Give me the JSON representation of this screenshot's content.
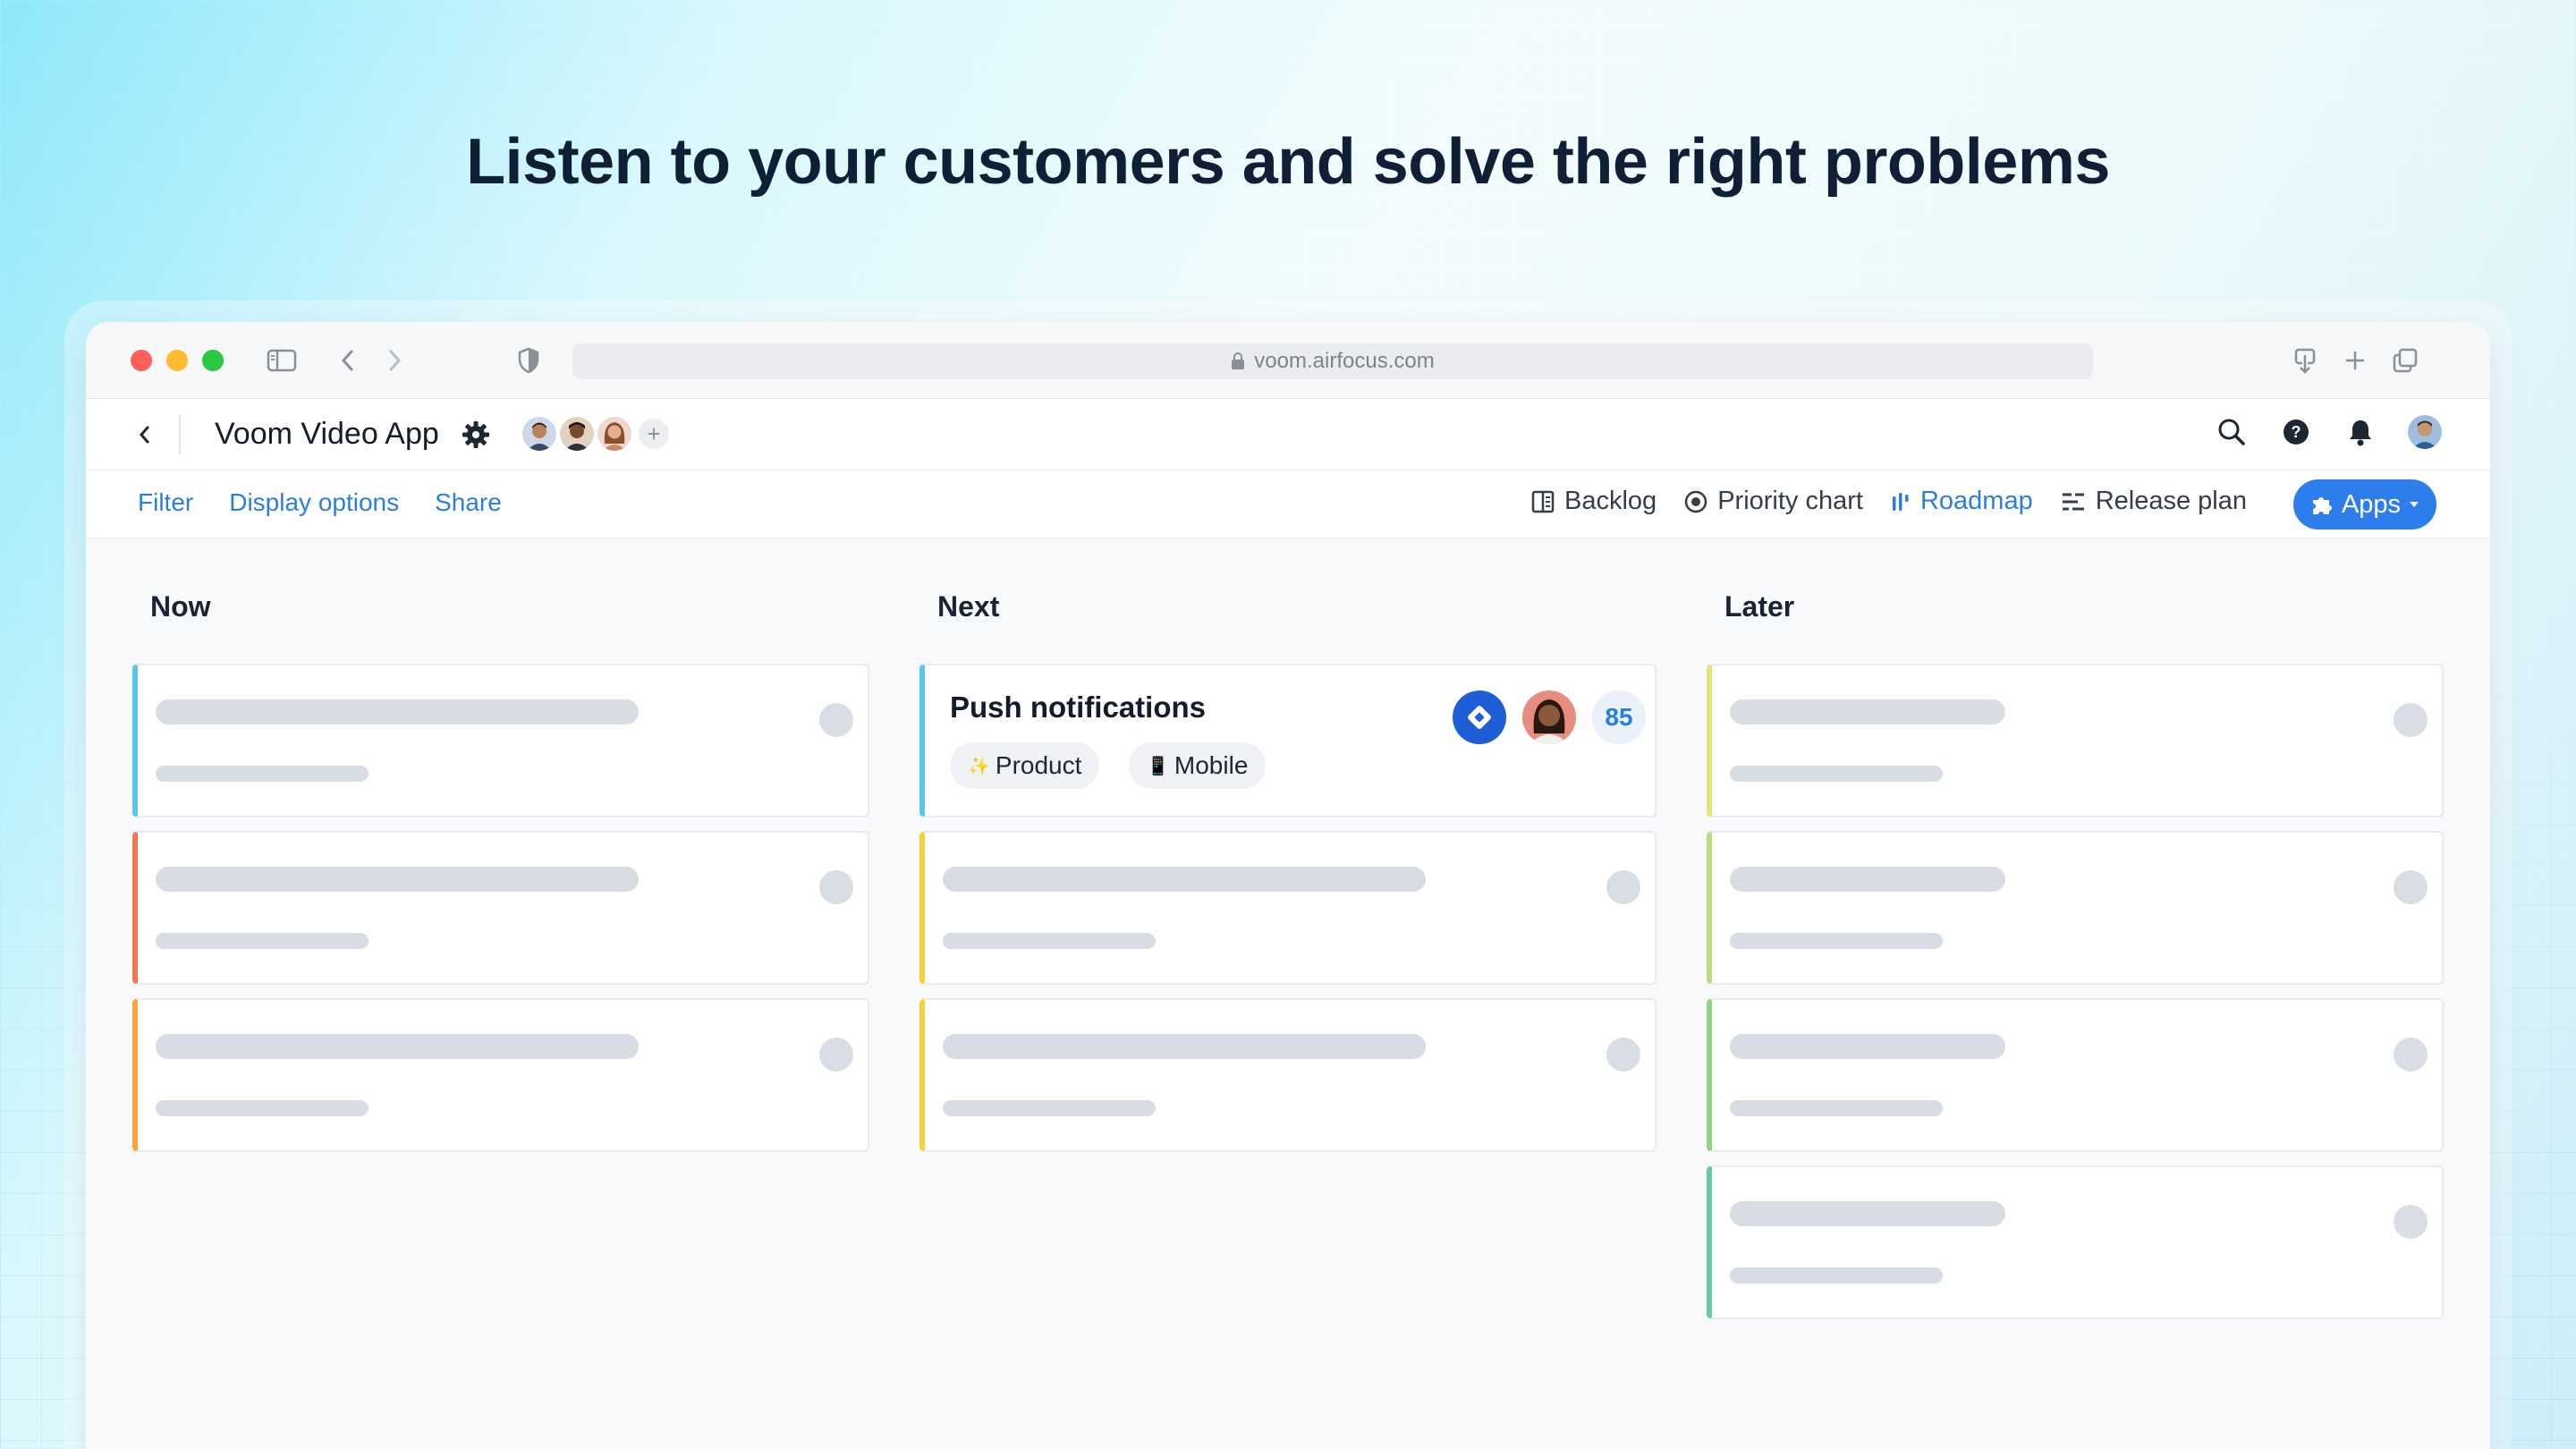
{
  "headline": "Listen to your customers and solve the right problems",
  "browser": {
    "url": "voom.airfocus.com",
    "icons": [
      "sidebar-icon",
      "back-icon",
      "forward-icon",
      "shield-icon",
      "download-icon",
      "new-tab-icon",
      "tabs-icon"
    ]
  },
  "app": {
    "title": "Voom Video App",
    "members_add": "+"
  },
  "toolbar": {
    "filter": "Filter",
    "display_options": "Display options",
    "share": "Share",
    "views": [
      {
        "label": "Backlog",
        "icon": "backlog-icon"
      },
      {
        "label": "Priority chart",
        "icon": "priority-chart-icon"
      },
      {
        "label": "Roadmap",
        "icon": "roadmap-icon",
        "active": true
      },
      {
        "label": "Release plan",
        "icon": "release-plan-icon"
      }
    ],
    "apps": "Apps"
  },
  "board": {
    "columns": [
      {
        "title": "Now",
        "card_colors": [
          "#5bc5ea",
          "#f07850",
          "#f7a534"
        ]
      },
      {
        "title": "Next",
        "card_colors": [
          "#5bc5ea",
          "#f6d13a",
          "#f6d13a"
        ]
      },
      {
        "title": "Later",
        "card_colors": [
          "#e5e37a",
          "#b9dc7c",
          "#93d284",
          "#6cc7a8"
        ]
      }
    ],
    "featured_card": {
      "title": "Push notifications",
      "tags": [
        {
          "emoji": "✨",
          "label": "Product"
        },
        {
          "emoji": "📱",
          "label": "Mobile"
        }
      ],
      "score": "85"
    }
  },
  "colors": {
    "accent": "#2b7fdc",
    "apps_button": "#2e7dec",
    "jira": "#1e5ed6"
  }
}
